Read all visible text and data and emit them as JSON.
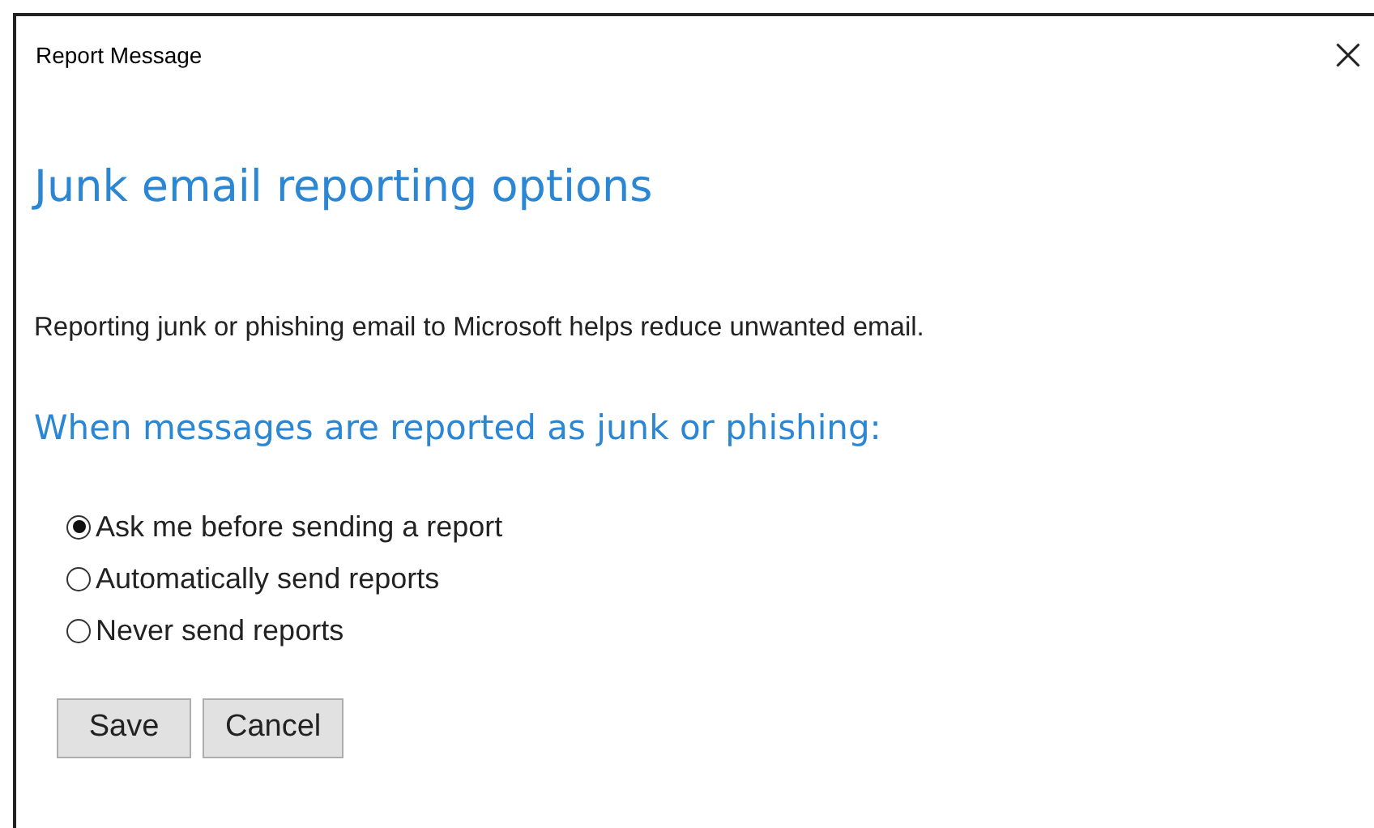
{
  "window": {
    "title": "Report Message"
  },
  "heading": "Junk email reporting options",
  "description": "Reporting junk or phishing email to Microsoft helps reduce unwanted email.",
  "subheading": "When messages are reported as junk or phishing:",
  "options": [
    {
      "label": "Ask me before sending a report",
      "selected": true
    },
    {
      "label": "Automatically send reports",
      "selected": false
    },
    {
      "label": "Never send reports",
      "selected": false
    }
  ],
  "buttons": [
    "Save",
    "Cancel"
  ]
}
